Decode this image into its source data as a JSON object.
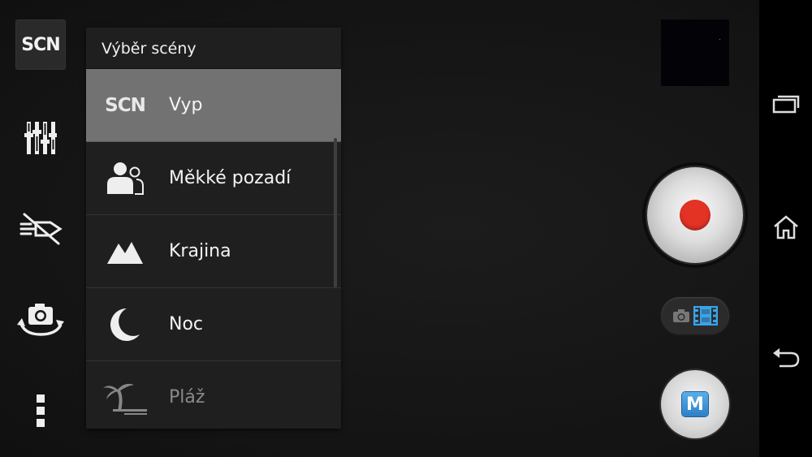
{
  "toolbar": {
    "scene_button_label": "SCN",
    "icons": [
      "settings-sliders-icon",
      "flash-off-icon",
      "switch-camera-icon",
      "more-menu-icon"
    ]
  },
  "scene_menu": {
    "title": "Výběr scény",
    "selected_index": 0,
    "items": [
      {
        "icon": "scn-icon",
        "icon_text": "SCN",
        "label": "Vyp"
      },
      {
        "icon": "soft-snap-portrait-icon",
        "label": "Měkké pozadí"
      },
      {
        "icon": "landscape-mountain-icon",
        "label": "Krajina"
      },
      {
        "icon": "night-moon-icon",
        "label": "Noc"
      },
      {
        "icon": "beach-palm-icon",
        "label": "Pláž"
      }
    ]
  },
  "right_controls": {
    "thumbnail": "last-photo-thumbnail",
    "record_button": "record-button",
    "mode_switch": {
      "photo_icon": "camera-icon",
      "video_icon": "film-icon",
      "active": "video"
    },
    "manual_mode_label": "M"
  },
  "colors": {
    "record_red": "#e33325",
    "video_blue": "#39a4ea",
    "selected_row": "#727272"
  }
}
